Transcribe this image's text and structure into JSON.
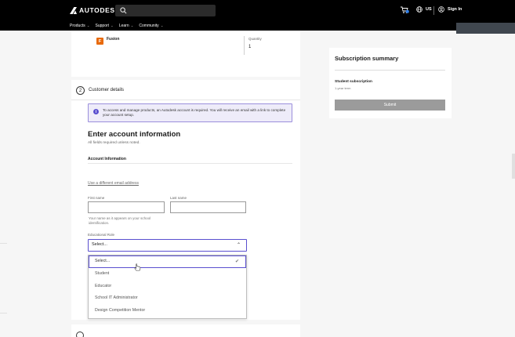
{
  "header": {
    "brand": "AUTODESK",
    "lang_label": "US",
    "signin_label": "Sign In"
  },
  "nav": {
    "items": [
      {
        "label": "Products"
      },
      {
        "label": "Support"
      },
      {
        "label": "Learn"
      },
      {
        "label": "Community"
      }
    ]
  },
  "product": {
    "name": "Fusion",
    "icon_letter": "F",
    "quantity_label": "Quantity",
    "quantity_value": "1"
  },
  "customer_details": {
    "step_number": "2",
    "title": "Customer details",
    "notice": "To access and manage products, an Autodesk account is required. You will receive an email with a link to complete your account setup.",
    "heading": "Enter account information",
    "required_note": "All fields required unless noted.",
    "section_label": "Account Information",
    "different_email_link": "Use a different email address",
    "first_name_label": "First name",
    "last_name_label": "Last name",
    "first_name_hint": "Your name as it appears on your school identification.",
    "role_label": "Educational Role",
    "role_value": "Select...",
    "role_options": [
      "Select...",
      "Student",
      "Educator",
      "School IT Administrator",
      "Design Competition Mentor"
    ]
  },
  "summary": {
    "title": "Subscription summary",
    "plan": "Student subscription",
    "term": "1-year term",
    "submit_label": "Submit"
  },
  "colors": {
    "accent": "#5a4fcf",
    "fusion_orange": "#e86a0c",
    "submit_disabled": "#9b9b9b"
  }
}
